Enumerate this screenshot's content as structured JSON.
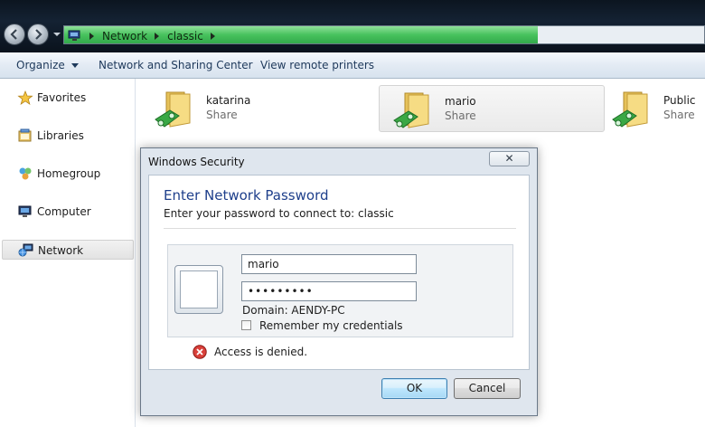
{
  "address_bar": {
    "breadcrumbs": [
      "Network",
      "classic"
    ],
    "progress_fraction": 0.74
  },
  "command_bar": {
    "organize": "Organize",
    "network_sharing_center": "Network and Sharing Center",
    "view_remote_printers": "View remote printers"
  },
  "nav_pane": {
    "items": [
      {
        "label": "Favorites",
        "icon": "star-icon"
      },
      {
        "label": "Libraries",
        "icon": "library-icon"
      },
      {
        "label": "Homegroup",
        "icon": "homegroup-icon"
      },
      {
        "label": "Computer",
        "icon": "computer-icon"
      },
      {
        "label": "Network",
        "icon": "network-icon",
        "selected": true
      }
    ]
  },
  "shares": [
    {
      "name": "katarina",
      "type": "Share"
    },
    {
      "name": "mario",
      "type": "Share",
      "selected": true
    },
    {
      "name": "Public",
      "type": "Share"
    }
  ],
  "dialog": {
    "title": "Windows Security",
    "close_glyph": "✕",
    "heading": "Enter Network Password",
    "instruction": "Enter your password to connect to: classic",
    "username_value": "mario",
    "password_value": "•••••••••",
    "domain": "Domain: AENDY-PC",
    "remember_label": "Remember my credentials",
    "remember_checked": false,
    "error_message": "Access is denied.",
    "ok_label": "OK",
    "cancel_label": "Cancel"
  },
  "colors": {
    "heading": "#1e3f8b",
    "progress": "#47c25d",
    "command_text": "#1e395b",
    "error": "#c8302c"
  }
}
